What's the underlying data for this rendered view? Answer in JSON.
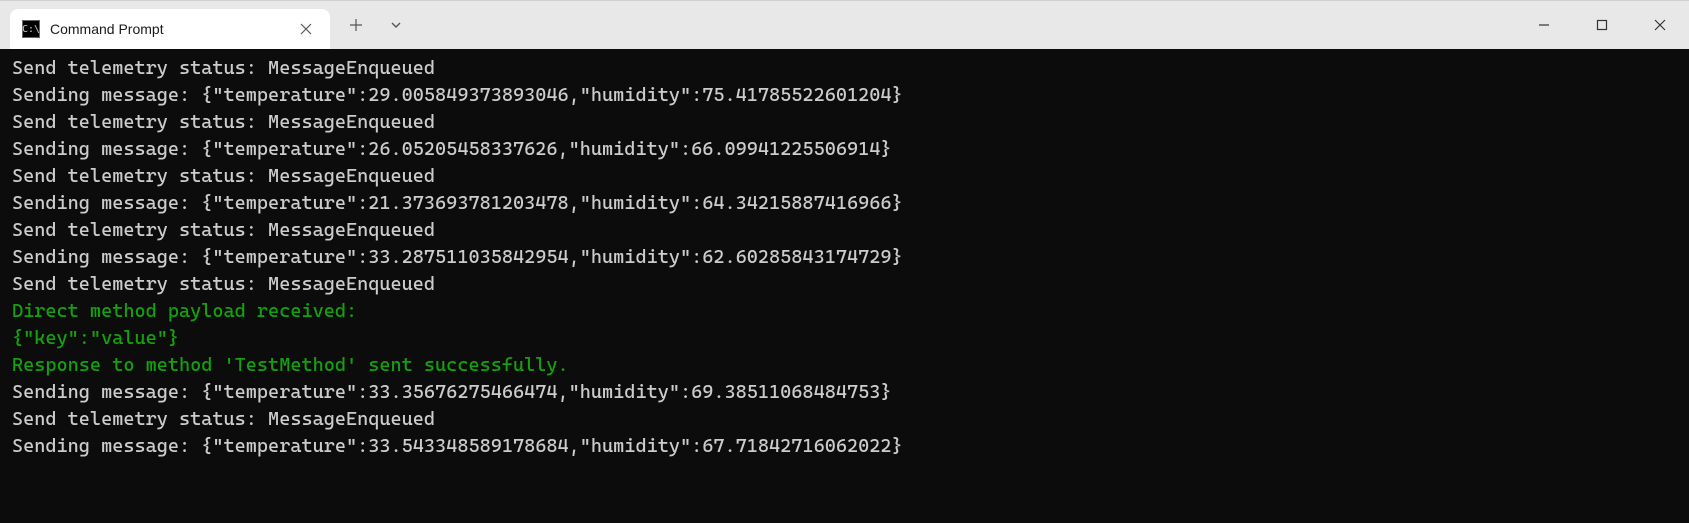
{
  "tab": {
    "title": "Command Prompt"
  },
  "status_text": "Send telemetry status: MessageEnqueued",
  "messages": [
    {
      "temperature": 29.005849373893046,
      "humidity": 75.41785522601204
    },
    {
      "temperature": 26.05205458337626,
      "humidity": 66.09941225506914
    },
    {
      "temperature": 21.373693781203478,
      "humidity": 64.34215887416966
    },
    {
      "temperature": 33.287511035842954,
      "humidity": 62.60285843174729
    },
    {
      "temperature": 33.35676275466474,
      "humidity": 69.38511068484753
    },
    {
      "temperature": 33.543348589178684,
      "humidity": 67.71842716062022
    }
  ],
  "direct_method": {
    "received_text": "Direct method payload received:",
    "payload": "{\"key\":\"value\"}",
    "response_text": "Response to method 'TestMethod' sent successfully."
  },
  "lines": [
    {
      "text": "Send telemetry status: MessageEnqueued",
      "color": "default"
    },
    {
      "text": "Sending message: {\"temperature\":29.005849373893046,\"humidity\":75.41785522601204}",
      "color": "default"
    },
    {
      "text": "Send telemetry status: MessageEnqueued",
      "color": "default"
    },
    {
      "text": "Sending message: {\"temperature\":26.05205458337626,\"humidity\":66.09941225506914}",
      "color": "default"
    },
    {
      "text": "Send telemetry status: MessageEnqueued",
      "color": "default"
    },
    {
      "text": "Sending message: {\"temperature\":21.373693781203478,\"humidity\":64.34215887416966}",
      "color": "default"
    },
    {
      "text": "Send telemetry status: MessageEnqueued",
      "color": "default"
    },
    {
      "text": "Sending message: {\"temperature\":33.287511035842954,\"humidity\":62.60285843174729}",
      "color": "default"
    },
    {
      "text": "Send telemetry status: MessageEnqueued",
      "color": "default"
    },
    {
      "text": "Direct method payload received:",
      "color": "green"
    },
    {
      "text": "{\"key\":\"value\"}",
      "color": "green"
    },
    {
      "text": "Response to method 'TestMethod' sent successfully.",
      "color": "green"
    },
    {
      "text": "Sending message: {\"temperature\":33.35676275466474,\"humidity\":69.38511068484753}",
      "color": "default"
    },
    {
      "text": "Send telemetry status: MessageEnqueued",
      "color": "default"
    },
    {
      "text": "Sending message: {\"temperature\":33.543348589178684,\"humidity\":67.71842716062022}",
      "color": "default"
    }
  ]
}
